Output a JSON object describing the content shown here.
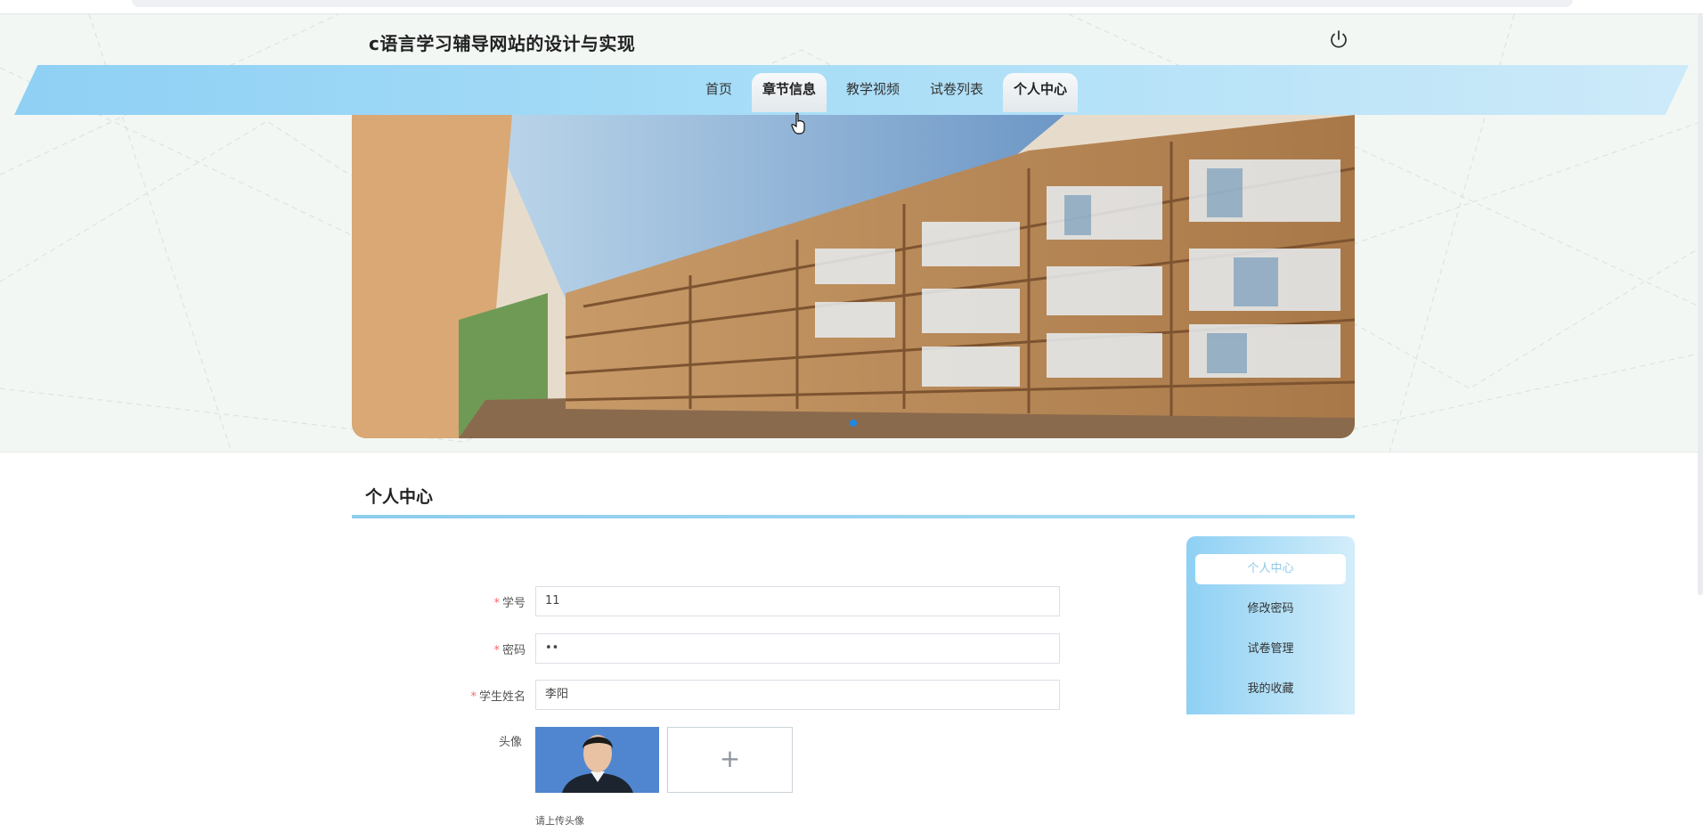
{
  "header": {
    "site_title": "c语言学习辅导网站的设计与实现",
    "logout_icon": "power-icon"
  },
  "nav": {
    "items": [
      {
        "label": "首页"
      },
      {
        "label": "章节信息"
      },
      {
        "label": "教学视频"
      },
      {
        "label": "试卷列表"
      },
      {
        "label": "个人中心"
      }
    ],
    "hovered": "章节信息",
    "active": "个人中心"
  },
  "banner": {
    "dots": 1,
    "active_dot": 1
  },
  "section": {
    "title": "个人中心"
  },
  "form": {
    "student_no_label": "学号",
    "student_no_value": "11",
    "password_label": "密码",
    "password_value": "••",
    "name_label": "学生姓名",
    "name_value": "李阳",
    "avatar_label": "头像",
    "upload_plus": "+",
    "upload_hint": "请上传头像",
    "required_mark": "*"
  },
  "side_menu": {
    "items": [
      {
        "label": "个人中心"
      },
      {
        "label": "修改密码"
      },
      {
        "label": "试卷管理"
      },
      {
        "label": "我的收藏"
      }
    ],
    "active": "个人中心"
  },
  "colors": {
    "accent": "#8fd0f4",
    "active_dot": "#1e88e5",
    "required": "#f56c6c"
  }
}
